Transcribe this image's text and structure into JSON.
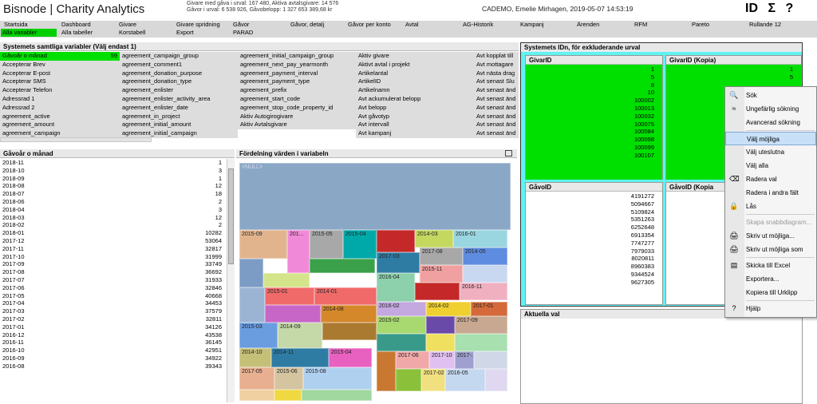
{
  "header": {
    "app_title": "Bisnode | Charity Analytics",
    "summary_line1": "Givare med gåva i urval: 167 480, Aktiva avtalsgivare: 14 576",
    "summary_line2": "Gåvor i urval: 6 538 926, Gåvobelopp: 1 327 653 389,68 kr",
    "user_line": "CADEMO, Emelie Mirhagen, 2019-05-07 14:53:19",
    "icon_id": "ID",
    "icon_sum": "Σ",
    "icon_help": "?"
  },
  "tabs": {
    "row1": [
      "Startsida",
      "Dashboard",
      "Givare",
      "Givare spridning",
      "Gåvor",
      "Gåvor, detalj",
      "Gåvor per konto",
      "Avtal",
      "AG-Historik",
      "Kampanj",
      "Ärenden",
      "RFM",
      "Pareto",
      "Rullande 12"
    ],
    "row2": [
      "Alla variabler",
      "Alla tabeller",
      "Korstabell",
      "Export",
      "PARAD"
    ]
  },
  "vars_panel": {
    "title": "Systemets samtliga variabler (Välj endast 1)",
    "selected_value": "59",
    "col1": [
      "Gåvoår o månad",
      "Accepterar Brev",
      "Accepterar E-post",
      "Accepterar SMS",
      "Accepterar Telefon",
      "Adressrad 1",
      "Adressrad 2",
      "agreement_active",
      "agreement_amount",
      "agreement_campaign"
    ],
    "col2": [
      "agreement_campaign_group",
      "agreement_comment1",
      "agreement_donation_purpose",
      "agreement_donation_type",
      "agreement_enlister",
      "agreement_enlister_activity_area",
      "agreement_enlister_date",
      "agreement_in_project",
      "agreement_initial_amount",
      "agreement_initial_campaign"
    ],
    "col3": [
      "agreement_initial_campaign_group",
      "agreement_next_pay_yearmonth",
      "agreement_payment_interval",
      "agreement_payment_type",
      "agreement_prefix",
      "agreement_start_code",
      "agreement_stop_code_property_id",
      "Aktiv Autogirogivare",
      "Aktiv Avtalsgivare"
    ],
    "col4": [
      "Aktiv givare",
      "Aktivt avtal i projekt",
      "Artikelantal",
      "ArtikelID",
      "Artikelnamn",
      "Avt ackumulerat belopp",
      "Avt belopp",
      "Avt gåvotyp",
      "Avt intervall",
      "Avt kampanj"
    ],
    "col5": [
      "Avt kopplat till",
      "Avt mottagare",
      "Avt nästa drag",
      "Avt senast Slu",
      "Avt senast änd",
      "Avt senast änd",
      "Avt senast änd",
      "Avt senast änd",
      "Avt senast änd",
      "Avt senast änd"
    ]
  },
  "gavo_panel": {
    "title": "Gåvoår o månad",
    "rows": [
      [
        "2018-11",
        "1"
      ],
      [
        "2018-10",
        "3"
      ],
      [
        "2018-09",
        "1"
      ],
      [
        "2018-08",
        "12"
      ],
      [
        "2018-07",
        "18"
      ],
      [
        "2018-06",
        "2"
      ],
      [
        "2018-04",
        "3"
      ],
      [
        "2018-03",
        "12"
      ],
      [
        "2018-02",
        "2"
      ],
      [
        "2018-01",
        "10282"
      ],
      [
        "2017-12",
        "53064"
      ],
      [
        "2017-11",
        "32817"
      ],
      [
        "2017-10",
        "31999"
      ],
      [
        "2017-09",
        "33749"
      ],
      [
        "2017-08",
        "36692"
      ],
      [
        "2017-07",
        "31933"
      ],
      [
        "2017-06",
        "32846"
      ],
      [
        "2017-05",
        "40668"
      ],
      [
        "2017-04",
        "34453"
      ],
      [
        "2017-03",
        "37579"
      ],
      [
        "2017-02",
        "32811"
      ],
      [
        "2017-01",
        "34126"
      ],
      [
        "2016-12",
        "43538"
      ],
      [
        "2016-11",
        "36145"
      ],
      [
        "2016-10",
        "42951"
      ],
      [
        "2016-09",
        "34922"
      ],
      [
        "2016-08",
        "39343"
      ]
    ]
  },
  "dist_panel": {
    "title": "Fördelning värden i variabeln",
    "cells": [
      "<NULL>",
      "2015-09",
      "201...",
      "2015-05",
      "2015-04",
      "2014-03",
      "2016-01",
      "2017-03",
      "2017-08",
      "2014-05",
      "2015-11",
      "2016-10",
      "2015-01",
      "2014-01",
      "2016-04",
      "2016-11",
      "2016-02",
      "2014-08",
      "2015-10",
      "2014-02",
      "2017-01",
      "2015-03",
      "2014-09",
      "2015-02",
      "2017-09",
      "2014-06",
      "2015-04",
      "2014-10",
      "2014-11",
      "2015-07",
      "2017-06",
      "2017-10",
      "2017-...",
      "2017-05",
      "2015-06",
      "2015-08",
      "2017-02",
      "2016-05"
    ]
  },
  "ids_panel": {
    "title": "Systemets IDn, för exkluderande urval",
    "givarid": {
      "title": "GivarID",
      "values": [
        "1",
        "5",
        "8",
        "10",
        "100002",
        "100013",
        "100032",
        "100075",
        "100084",
        "100098",
        "100099",
        "100107"
      ]
    },
    "givarid_kopia": {
      "title": "GivarID (Kopia)",
      "values": [
        "1",
        "5"
      ]
    },
    "gavoid": {
      "title": "GåvoID",
      "values": [
        "4191272",
        "5094667",
        "5109824",
        "5351263",
        "6252648",
        "6913354",
        "7747277",
        "7979033",
        "8020811",
        "8960383",
        "9344524",
        "9627305"
      ]
    },
    "gavoid_kopia": {
      "title": "GåvoID (Kopia"
    }
  },
  "aktuella": {
    "title": "Aktuella val"
  },
  "context_menu": {
    "items": [
      "Sök",
      "Ungefärlig sökning",
      "Avancerad sökning",
      "Välj möjliga",
      "Välj uteslutna",
      "Välj alla",
      "Radera val",
      "Radera i andra fält",
      "Lås",
      "Skapa snabbdiagram...",
      "Skriv ut möjliga...",
      "Skriv ut möjliga som",
      "Skicka till Excel",
      "Exportera...",
      "Kopiera till Urklipp",
      "Hjälp"
    ],
    "highlighted": "Välj möjliga",
    "disabled": "Skapa snabbdiagram..."
  },
  "colors": {
    "selected_green": "#00e000",
    "ids_background": "#5ff3f3",
    "menu_highlight": "#c8e0f8"
  }
}
